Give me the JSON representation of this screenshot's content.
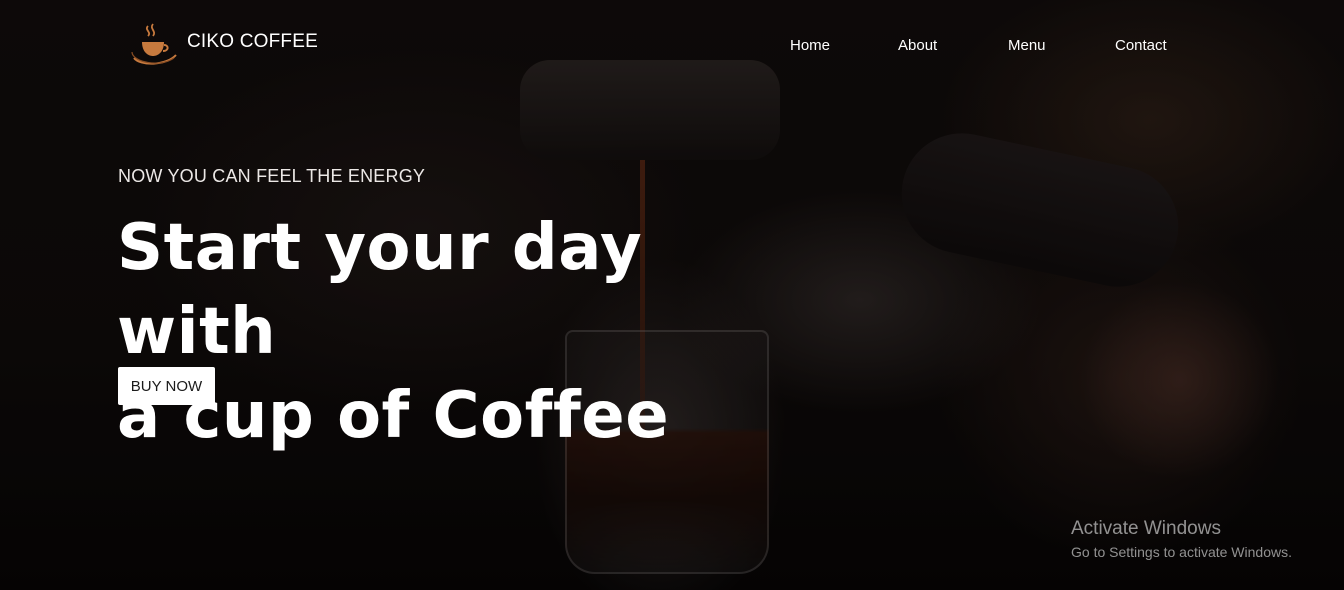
{
  "header": {
    "brand": "CIKO COFFEE",
    "logo_icon": "coffee-cup-icon",
    "nav": {
      "home": "Home",
      "about": "About",
      "menu": "Menu",
      "contact": "Contact"
    }
  },
  "hero": {
    "tagline": "NOW YOU CAN FEEL THE ENERGY",
    "headline_line1": "Start your day with",
    "headline_line2": "a cup of Coffee",
    "cta_label": "BUY NOW"
  },
  "watermark": {
    "title": "Activate Windows",
    "subtitle": "Go to Settings to activate Windows."
  },
  "colors": {
    "logo_accent": "#c77a3e",
    "text": "#ffffff",
    "button_bg": "#ffffff",
    "button_text": "#1b1b1b"
  }
}
